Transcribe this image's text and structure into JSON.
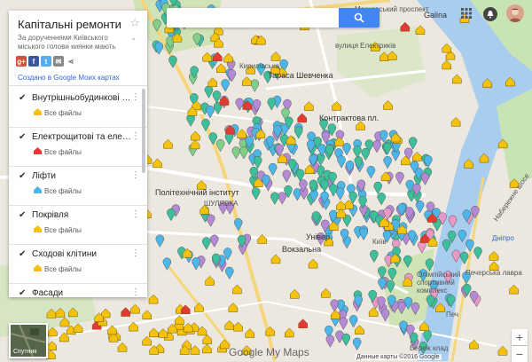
{
  "search": {
    "value": "",
    "placeholder": ""
  },
  "panel": {
    "title": "Капітальні ремонти",
    "description": "За дорученнями Київського міського голови киянки мають",
    "created_link": "Создано в Google Моих картах",
    "share_icons": [
      "google-plus-icon",
      "facebook-icon",
      "twitter-icon",
      "email-icon",
      "share-icon"
    ],
    "layers": [
      {
        "name": "Внутрішньобудинкові м...",
        "sub": "Все файлы",
        "icon_color": "#f4c20d"
      },
      {
        "name": "Електрощитові та елект...",
        "sub": "Все файлы",
        "icon_color": "#e53935"
      },
      {
        "name": "Ліфти",
        "sub": "Все файлы",
        "icon_color": "#4db6e8"
      },
      {
        "name": "Покрівля",
        "sub": "Все файлы",
        "icon_color": "#f4c20d"
      },
      {
        "name": "Сходові клітини",
        "sub": "Все файлы",
        "icon_color": "#f4c20d"
      },
      {
        "name": "Фасади",
        "sub": "",
        "icon_color": "#f4c20d"
      }
    ]
  },
  "map": {
    "labels": {
      "moskovskyi": "Московський проспект",
      "galina": "Galina",
      "elektrykiv": "вулиця Електриків",
      "shevchenka": "Тараса Шевченка",
      "kontraktova": "Контрактова пл.",
      "kyrylivska": "Кирилівська",
      "shuliavka": "ШУЛЯВКА",
      "politekh": "Політехнічний інститут",
      "vokzalna": "Вокзальна",
      "olimpiyska": "Олімпійський спортивний комплекс",
      "dnipro": "Дніпро",
      "pechersk": "Печерська лавра",
      "naberezhne": "Набережне шосе",
      "pechersk2": "Печ",
      "univ": "Універ",
      "kyiv": "Київ",
      "bereg": "Береж клад"
    },
    "brand": "Google My Maps",
    "copyright": "Данные карты ©2016 Google"
  },
  "satellite_label": "Спутник",
  "zoom": {
    "in": "+",
    "out": "−"
  },
  "colors": {
    "blue": "#4db6e8",
    "teal": "#3cbf9a",
    "purple": "#b38ad3",
    "pink": "#e89ac6",
    "green": "#7fcf8a",
    "yellow": "#f4c20d",
    "red": "#e53935"
  }
}
